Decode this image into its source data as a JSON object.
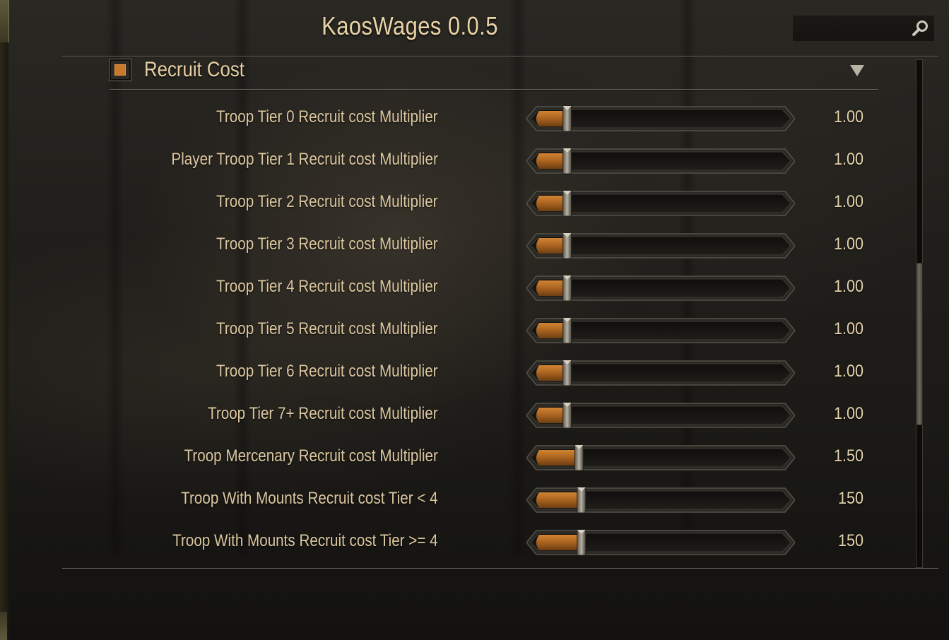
{
  "window": {
    "title": "KaosWages 0.0.5"
  },
  "search": {
    "icon": "search-icon",
    "placeholder": ""
  },
  "section": {
    "title": "Recruit Cost",
    "checked": true,
    "expanded": true,
    "collapse_icon": "triangle-down-icon"
  },
  "settings": [
    {
      "label": "Troop Tier 0 Recruit cost Multiplier",
      "value": "1.00",
      "slider_fraction": 0.1
    },
    {
      "label": "Player Troop Tier 1 Recruit cost Multiplier",
      "value": "1.00",
      "slider_fraction": 0.1
    },
    {
      "label": "Troop Tier 2 Recruit cost Multiplier",
      "value": "1.00",
      "slider_fraction": 0.1
    },
    {
      "label": "Troop Tier 3 Recruit cost Multiplier",
      "value": "1.00",
      "slider_fraction": 0.1
    },
    {
      "label": "Troop Tier 4 Recruit cost Multiplier",
      "value": "1.00",
      "slider_fraction": 0.1
    },
    {
      "label": "Troop Tier 5 Recruit cost Multiplier",
      "value": "1.00",
      "slider_fraction": 0.1
    },
    {
      "label": "Troop Tier 6 Recruit cost Multiplier",
      "value": "1.00",
      "slider_fraction": 0.1
    },
    {
      "label": "Troop Tier 7+ Recruit cost Multiplier",
      "value": "1.00",
      "slider_fraction": 0.1
    },
    {
      "label": "Troop Mercenary Recruit cost Multiplier",
      "value": "1.50",
      "slider_fraction": 0.15
    },
    {
      "label": "Troop With Mounts Recruit cost Tier < 4",
      "value": "150",
      "slider_fraction": 0.16
    },
    {
      "label": "Troop With Mounts Recruit cost Tier >= 4",
      "value": "150",
      "slider_fraction": 0.16
    }
  ],
  "scrollbar": {
    "thumb_start_fraction": 0.4,
    "thumb_size_fraction": 0.32
  },
  "colors": {
    "accent_orange": "#c77a2a",
    "text_gold": "#dcc7a0",
    "title_gold": "#e9d3a6"
  }
}
